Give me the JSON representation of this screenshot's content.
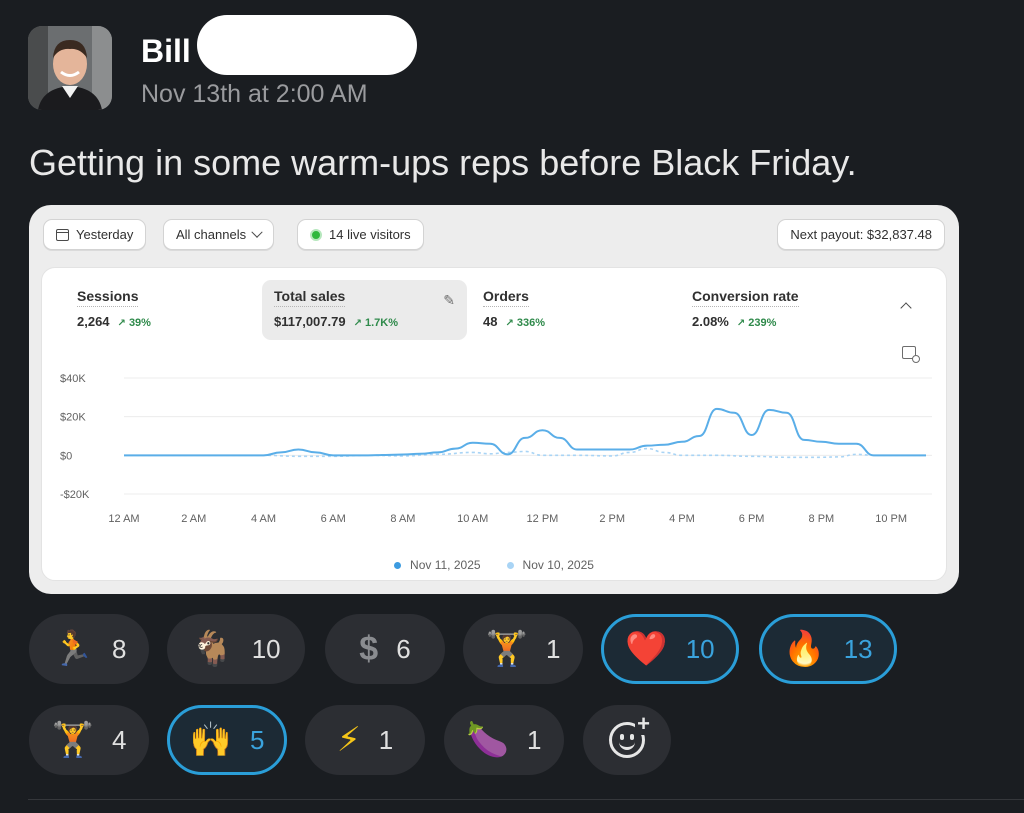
{
  "message": {
    "author": "Bill",
    "timestamp": "Nov 13th at 2:00 AM",
    "text": "Getting in some warm-ups reps before Black Friday."
  },
  "dashboard": {
    "date_filter": "Yesterday",
    "channel_filter": "All channels",
    "live_visitors": "14 live visitors",
    "next_payout": "Next payout: $32,837.48",
    "metrics": [
      {
        "label": "Sessions",
        "value": "2,264",
        "change": "39%"
      },
      {
        "label": "Total sales",
        "value": "$117,007.79",
        "change": "1.7K%"
      },
      {
        "label": "Orders",
        "value": "48",
        "change": "336%"
      },
      {
        "label": "Conversion rate",
        "value": "2.08%",
        "change": "239%"
      }
    ],
    "chart_data": {
      "type": "line",
      "x_labels": [
        "12 AM",
        "2 AM",
        "4 AM",
        "6 AM",
        "8 AM",
        "10 AM",
        "12 PM",
        "2 PM",
        "4 PM",
        "6 PM",
        "8 PM",
        "10 PM"
      ],
      "y_ticks": [
        "$40K",
        "$20K",
        "$0",
        "-$20K"
      ],
      "ylim": [
        -20000,
        40000
      ],
      "series": [
        {
          "name": "Nov 11, 2025",
          "color": "#5aaee8",
          "x": [
            0,
            1,
            2,
            3,
            4,
            4.5,
            5,
            5.5,
            6,
            6.5,
            7,
            7.5,
            8,
            8.5,
            9,
            9.5,
            10,
            10.5,
            11,
            11.5,
            12,
            12.5,
            13,
            13.5,
            14,
            14.5,
            15,
            15.5,
            16,
            16.5,
            17,
            17.5,
            18,
            18.5,
            19,
            19.5,
            20,
            20.5,
            21,
            21.5,
            22,
            22.5,
            23
          ],
          "values": [
            0,
            0,
            0,
            0,
            0,
            1500,
            3000,
            1500,
            0,
            0,
            0,
            200,
            400,
            800,
            1500,
            3500,
            6500,
            6000,
            500,
            9000,
            13000,
            9000,
            3000,
            3000,
            3000,
            3000,
            5000,
            5500,
            7000,
            10000,
            24000,
            22000,
            10500,
            23500,
            22000,
            8000,
            7000,
            6000,
            6000,
            0,
            0,
            0,
            0
          ]
        },
        {
          "name": "Nov 10, 2025",
          "color": "#a9d4f5",
          "x": [
            0,
            1,
            2,
            3,
            4,
            5,
            6,
            7,
            8,
            9,
            10,
            10.5,
            11,
            11.5,
            12,
            13,
            14,
            14.5,
            15,
            15.5,
            16,
            17,
            18,
            19,
            20,
            20.5,
            21,
            21.5,
            22,
            23
          ],
          "values": [
            0,
            0,
            0,
            0,
            0,
            -500,
            -500,
            0,
            -300,
            500,
            1500,
            800,
            1500,
            2000,
            0,
            0,
            -300,
            1500,
            3500,
            1500,
            0,
            0,
            -500,
            -1000,
            -1000,
            -800,
            500,
            0,
            0,
            0
          ]
        }
      ]
    }
  },
  "reactions": [
    {
      "emoji": "🏃",
      "count": "8",
      "mine": false
    },
    {
      "emoji": "🐐",
      "count": "10",
      "mine": false
    },
    {
      "emoji": "$",
      "count": "6",
      "mine": false
    },
    {
      "emoji": "🏋",
      "count": "1",
      "mine": false
    },
    {
      "emoji": "❤️",
      "count": "10",
      "mine": true
    },
    {
      "emoji": "🔥",
      "count": "13",
      "mine": true
    },
    {
      "emoji": "🏋",
      "count": "4",
      "mine": false
    },
    {
      "emoji": "🙌",
      "count": "5",
      "mine": true
    },
    {
      "emoji": "⚡",
      "count": "1",
      "mine": false
    },
    {
      "emoji": "🍆",
      "count": "1",
      "mine": false
    }
  ],
  "icons": {
    "avatar": "avatar",
    "add_reaction": "add-reaction-icon"
  }
}
